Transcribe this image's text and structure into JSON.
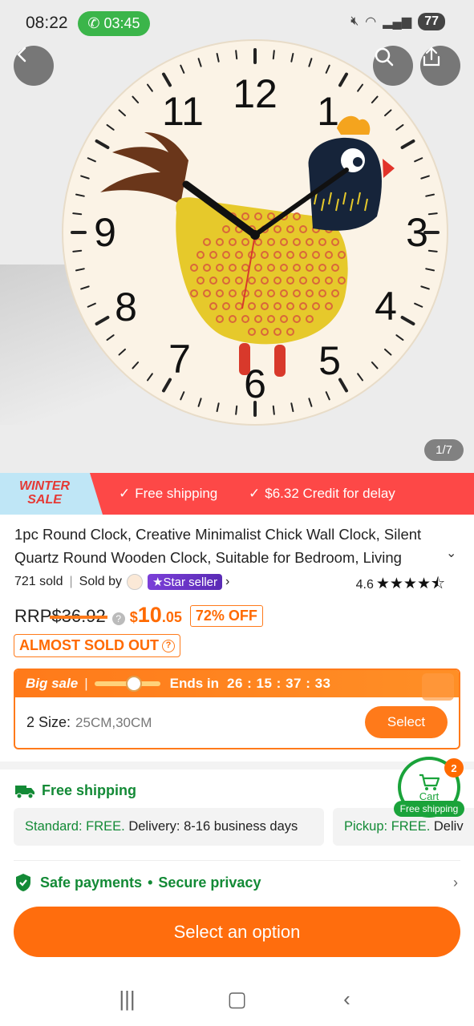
{
  "status": {
    "time": "08:22",
    "call_timer": "03:45",
    "battery": "77"
  },
  "gallery": {
    "counter": "1/7",
    "clock_numerals": [
      "12",
      "1",
      "3",
      "4",
      "5",
      "6",
      "7",
      "8",
      "9",
      "11"
    ]
  },
  "promo": {
    "badge_line1": "WINTER",
    "badge_line2": "SALE",
    "item1": "Free shipping",
    "item2": "$6.32 Credit for delay"
  },
  "product": {
    "title": "1pc Round Clock, Creative Minimalist Chick Wall Clock, Silent Quartz Round Wooden Clock, Suitable for Bedroom, Living",
    "sold": "721 sold",
    "sold_by": "Sold by",
    "star_seller": "Star seller",
    "rating": "4.6",
    "stars": "★★★★⯪"
  },
  "price": {
    "rrp_label": "RRP",
    "rrp_value": "$36.92",
    "currency": "$",
    "integer": "10",
    "decimal": ".05",
    "discount": "72% OFF",
    "almost_sold_out": "ALMOST SOLD OUT"
  },
  "sale": {
    "label": "Big sale",
    "ends_label": "Ends in",
    "countdown": "26 : 15 : 37 : 33",
    "progress": 0.6,
    "size_label": "2 Size:",
    "size_values": "25CM,30CM",
    "select_label": "Select"
  },
  "shipping": {
    "title": "Free shipping",
    "standard_label": "Standard: FREE.",
    "standard_detail": "Delivery: 8-16 business days",
    "pickup_label": "Pickup: FREE.",
    "pickup_detail": "Deliv"
  },
  "cart": {
    "label": "Cart",
    "count": "2",
    "badge": "Free shipping"
  },
  "safety": {
    "safe_payments": "Safe payments",
    "secure_privacy": "Secure privacy"
  },
  "cta": {
    "label": "Select an option"
  },
  "colors": {
    "accent_orange": "#ff6d0d",
    "promo_red": "#fd4847",
    "green": "#138a36",
    "star_seller_purple": "#6b34c6"
  }
}
